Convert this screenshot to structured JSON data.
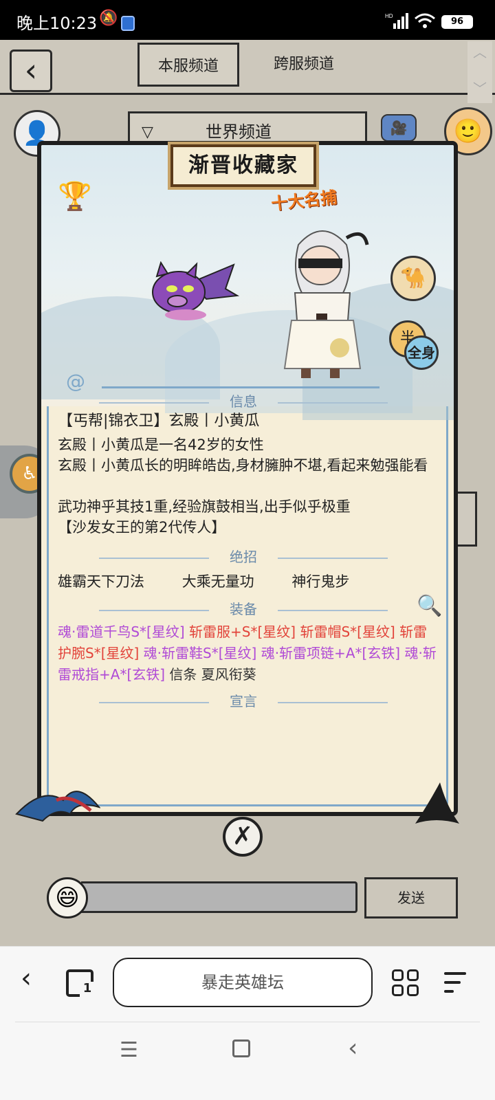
{
  "status_bar": {
    "time": "晚上10:23",
    "battery": "96"
  },
  "header": {
    "tabs": [
      "本服频道",
      "跨服频道"
    ],
    "channel": "世界频道"
  },
  "card": {
    "title": "渐晋收藏家",
    "rank_title": "十大名捕",
    "view_buttons": {
      "half": "半",
      "full": "全身"
    },
    "sections": {
      "info": "信息",
      "skills": "绝招",
      "equipment": "装备",
      "declaration": "宣言"
    },
    "info_lines": [
      "【丐帮|锦衣卫】玄殿丨小黄瓜",
      "玄殿丨小黄瓜是一名42岁的女性",
      "玄殿丨小黄瓜长的明眸皓齿,身材臃肿不堪,看起来勉强能看",
      "武功神乎其技1重,经验旗鼓相当,出手似乎极重",
      "【沙发女王的第2代传人】"
    ],
    "skills": [
      "雄霸天下刀法",
      "大乘无量功",
      "神行鬼步"
    ],
    "equipment": [
      {
        "text": "魂·雷道千鸟S*[星纹]",
        "color": "purple"
      },
      {
        "text": "斩雷服+S*[星纹]",
        "color": "red"
      },
      {
        "text": "斩雷帽S*[星纹]",
        "color": "red"
      },
      {
        "text": "斩雷护腕S*[星纹]",
        "color": "red"
      },
      {
        "text": "魂·斩雷鞋S*[星纹]",
        "color": "purple"
      },
      {
        "text": "魂·斩雷项链+A*[玄铁]",
        "color": "purple"
      },
      {
        "text": "魂·斩雷戒指+A*[玄铁]",
        "color": "purple"
      },
      {
        "text": "信条",
        "color": "dark"
      },
      {
        "text": "夏风衔葵",
        "color": "dark"
      }
    ]
  },
  "chat": {
    "send_label": "发送",
    "input_value": ""
  },
  "browser": {
    "url_text": "暴走英雄坛",
    "tab_count": "1"
  },
  "colors": {
    "purple": "#b04ad6",
    "red": "#e2433a",
    "dark": "#333333"
  }
}
